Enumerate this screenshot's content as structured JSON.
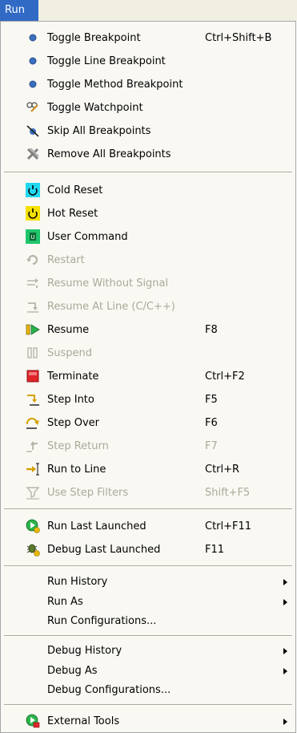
{
  "menubar": {
    "title": "Run"
  },
  "groups": {
    "breakpoints": [
      {
        "label": "Toggle Breakpoint",
        "shortcut": "Ctrl+Shift+B"
      },
      {
        "label": "Toggle Line Breakpoint",
        "shortcut": ""
      },
      {
        "label": "Toggle Method Breakpoint",
        "shortcut": ""
      },
      {
        "label": "Toggle Watchpoint",
        "shortcut": ""
      },
      {
        "label": "Skip All Breakpoints",
        "shortcut": ""
      },
      {
        "label": "Remove All Breakpoints",
        "shortcut": ""
      }
    ],
    "execution": [
      {
        "label": "Cold Reset",
        "shortcut": ""
      },
      {
        "label": "Hot Reset",
        "shortcut": ""
      },
      {
        "label": "User Command",
        "shortcut": ""
      },
      {
        "label": "Restart",
        "shortcut": ""
      },
      {
        "label": "Resume Without Signal",
        "shortcut": ""
      },
      {
        "label": "Resume At Line (C/C++)",
        "shortcut": ""
      },
      {
        "label": "Resume",
        "shortcut": "F8"
      },
      {
        "label": "Suspend",
        "shortcut": ""
      },
      {
        "label": "Terminate",
        "shortcut": "Ctrl+F2"
      },
      {
        "label": "Step Into",
        "shortcut": "F5"
      },
      {
        "label": "Step Over",
        "shortcut": "F6"
      },
      {
        "label": "Step Return",
        "shortcut": "F7"
      },
      {
        "label": "Run to Line",
        "shortcut": "Ctrl+R"
      },
      {
        "label": "Use Step Filters",
        "shortcut": "Shift+F5"
      }
    ],
    "launch": [
      {
        "label": "Run Last Launched",
        "shortcut": "Ctrl+F11"
      },
      {
        "label": "Debug Last Launched",
        "shortcut": "F11"
      }
    ],
    "run": [
      {
        "label": "Run History"
      },
      {
        "label": "Run As"
      },
      {
        "label": "Run Configurations..."
      }
    ],
    "debug": [
      {
        "label": "Debug History"
      },
      {
        "label": "Debug As"
      },
      {
        "label": "Debug Configurations..."
      }
    ],
    "tools": [
      {
        "label": "External Tools"
      }
    ]
  },
  "colors": {
    "selection": "#316ac5",
    "disabled_text": "#aca899",
    "menu_bg": "#f9f8f3",
    "cold_reset": "#22d8f0",
    "hot_reset": "#f5e000",
    "user_command": "#1fc46a",
    "terminate": "#e0242a"
  }
}
